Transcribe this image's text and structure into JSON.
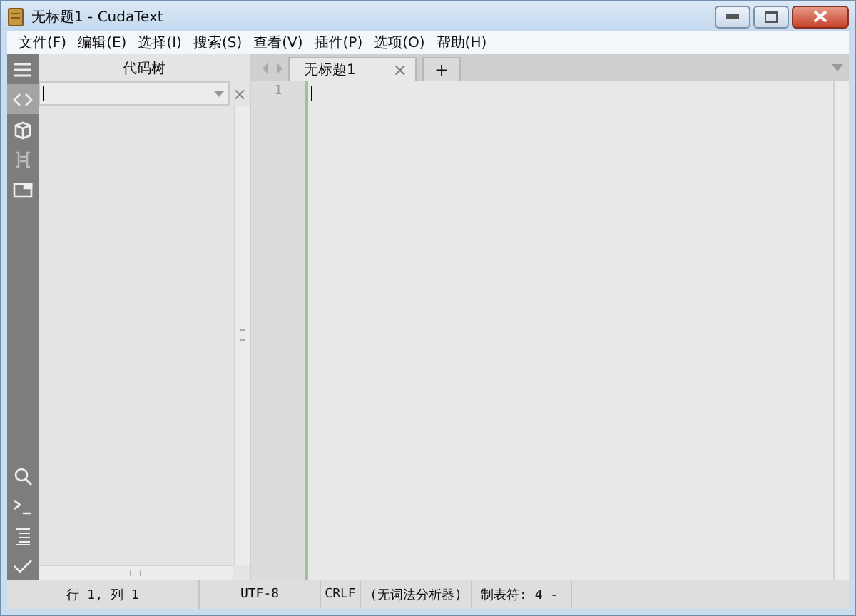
{
  "window": {
    "title": "无标题1 - CudaText"
  },
  "menu": [
    "文件(F)",
    "编辑(E)",
    "选择(I)",
    "搜索(S)",
    "查看(V)",
    "插件(P)",
    "选项(O)",
    "帮助(H)"
  ],
  "sidebar": {
    "top": [
      {
        "kind": "menu",
        "selected": false
      },
      {
        "kind": "code",
        "selected": true
      },
      {
        "kind": "box",
        "selected": false
      },
      {
        "kind": "list",
        "selected": false
      },
      {
        "kind": "folder",
        "selected": false
      }
    ],
    "bottom": [
      {
        "kind": "search"
      },
      {
        "kind": "console"
      },
      {
        "kind": "lines"
      },
      {
        "kind": "check"
      }
    ]
  },
  "panel": {
    "title": "代码树",
    "close": "×"
  },
  "tabs": [
    {
      "label": "无标题1",
      "selected": true,
      "close": "×"
    }
  ],
  "add_tab": "+",
  "line_numbers": [
    "1"
  ],
  "status_bar": [
    "行 1, 列 1",
    "UTF-8",
    "CRLF",
    "(无词法分析器)",
    "制表符: 4 -"
  ]
}
